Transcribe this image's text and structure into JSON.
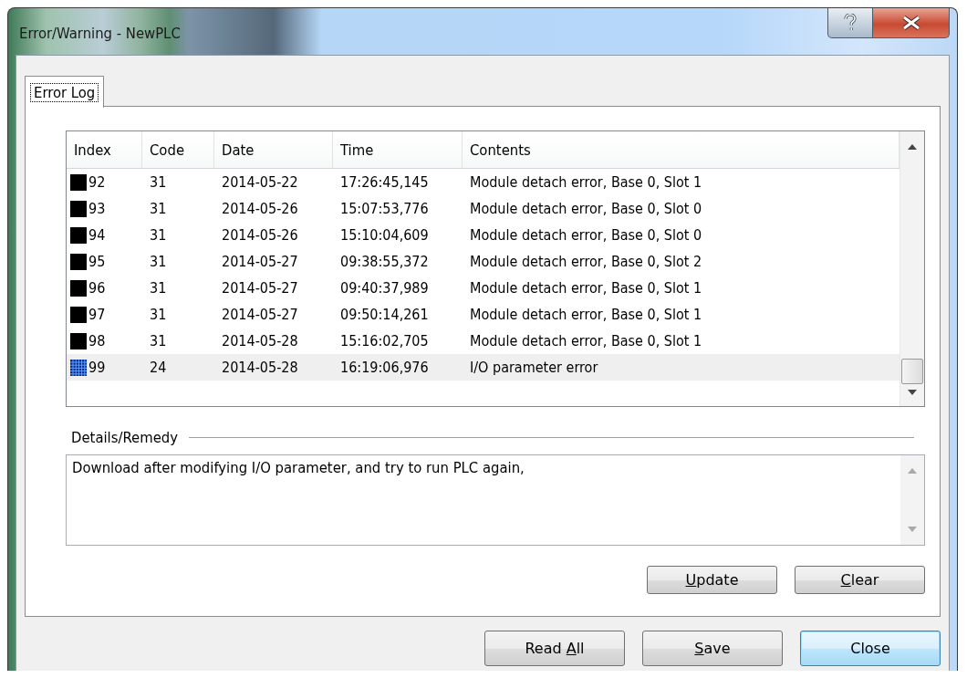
{
  "window": {
    "title": "Error/Warning - NewPLC"
  },
  "tabs": [
    {
      "label": "Error Log",
      "selected": true
    }
  ],
  "table": {
    "columns": [
      "Index",
      "Code",
      "Date",
      "Time",
      "Contents"
    ],
    "rows": [
      {
        "index": "92",
        "code": "31",
        "date": "2014-05-22",
        "time": "17:26:45,145",
        "contents": "Module detach error, Base 0, Slot 1",
        "selected": false
      },
      {
        "index": "93",
        "code": "31",
        "date": "2014-05-26",
        "time": "15:07:53,776",
        "contents": "Module detach error, Base 0, Slot 0",
        "selected": false
      },
      {
        "index": "94",
        "code": "31",
        "date": "2014-05-26",
        "time": "15:10:04,609",
        "contents": "Module detach error, Base 0, Slot 0",
        "selected": false
      },
      {
        "index": "95",
        "code": "31",
        "date": "2014-05-27",
        "time": "09:38:55,372",
        "contents": "Module detach error, Base 0, Slot 2",
        "selected": false
      },
      {
        "index": "96",
        "code": "31",
        "date": "2014-05-27",
        "time": "09:40:37,989",
        "contents": "Module detach error, Base 0, Slot 1",
        "selected": false
      },
      {
        "index": "97",
        "code": "31",
        "date": "2014-05-27",
        "time": "09:50:14,261",
        "contents": "Module detach error, Base 0, Slot 1",
        "selected": false
      },
      {
        "index": "98",
        "code": "31",
        "date": "2014-05-28",
        "time": "15:16:02,705",
        "contents": "Module detach error, Base 0, Slot 1",
        "selected": false
      },
      {
        "index": "99",
        "code": "24",
        "date": "2014-05-28",
        "time": "16:19:06,976",
        "contents": "I/O parameter error",
        "selected": true
      }
    ]
  },
  "details": {
    "label": "Details/Remedy",
    "value": "Download after modifying I/O parameter, and try to run PLC again,"
  },
  "panel_buttons": [
    {
      "label": {
        "key": "U",
        "post": "pdate"
      },
      "focused": false
    },
    {
      "label": {
        "key": "C",
        "post": "lear"
      },
      "focused": false
    }
  ],
  "dialog_buttons": [
    {
      "label": {
        "pre": "Read ",
        "key": "A",
        "post": "ll"
      },
      "focused": false
    },
    {
      "label": {
        "key": "S",
        "post": "ave"
      },
      "focused": false
    },
    {
      "label": {
        "pre": "Close"
      },
      "focused": true
    }
  ]
}
